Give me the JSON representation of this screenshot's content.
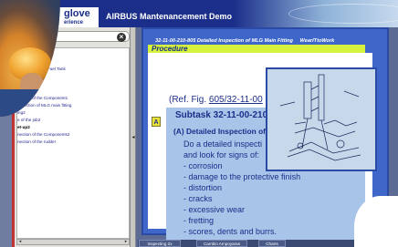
{
  "header": {
    "logo_main": "glove",
    "logo_sub": "erience",
    "title": "AIRBUS Mantenancement Demo"
  },
  "nav": {
    "search_value": "",
    "tree_items": [
      "nection of Inner Fuel Tank",
      "ing1",
      "e of the job1",
      "ent-up1",
      "nection of the Component1",
      "nspection of MLG main fitting",
      "ing2",
      "e of the job2",
      "et-up2",
      "nection of the Components2",
      "nection of the rudder"
    ],
    "selected_index": 8
  },
  "document": {
    "heading": "32-11-00-210-805 Detailed Inspection of MLG Main Fitting",
    "heading_tag": "WearITtoWork",
    "procedure_label": "Procedure",
    "ref_prefix": "(Ref. Fig. ",
    "ref_link": "605/32-11-00",
    "subtask": "Subtask 32-11-00-210",
    "step_letter": "A",
    "step_title": "(A)  Detailed Inspection of",
    "step_line1": "Do a detailed inspecti",
    "step_line2": "and look for signs of:",
    "bullets": [
      "- corrosion",
      "- damage to the protective finish",
      "- distortion",
      "- cracks",
      "- excessive wear",
      "- fretting",
      "- scores, dents and burrs."
    ]
  },
  "tabs": [
    "Inspecting 2x",
    "Cambio Ampoyaras",
    "Charts"
  ],
  "colors": {
    "header_bg": "#1b2f8a",
    "nav_accent": "#c33232",
    "doc_frame": "#3f66c9",
    "procedure_bar": "#d6f23c"
  }
}
